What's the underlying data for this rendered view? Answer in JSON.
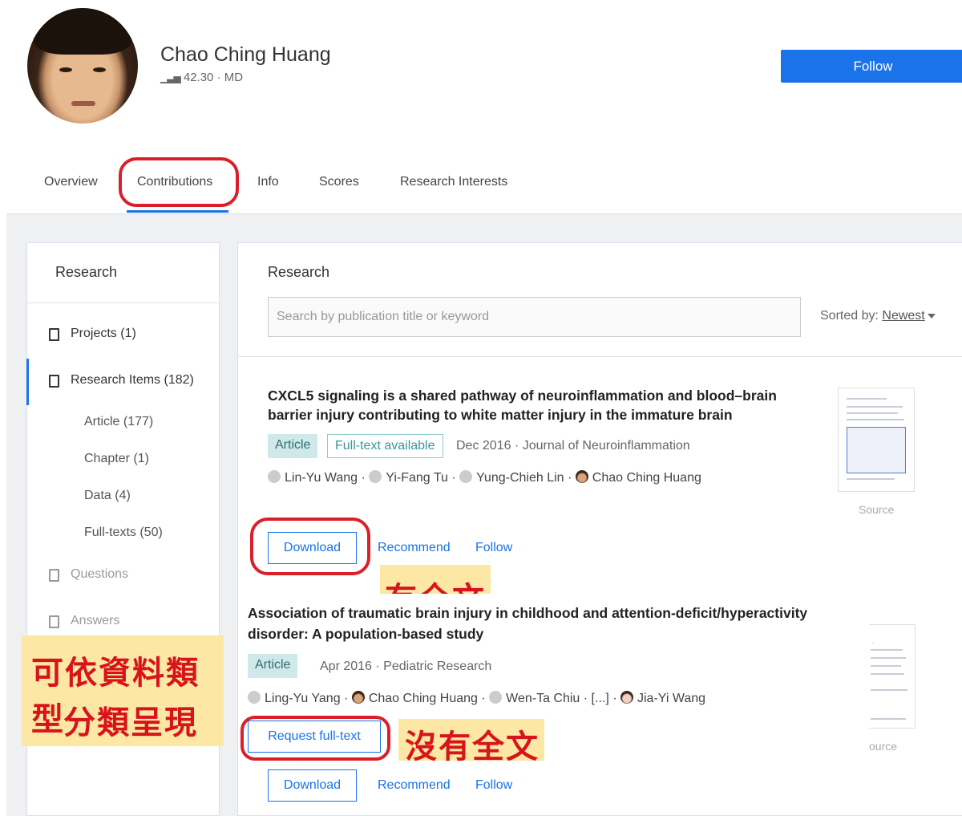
{
  "profile": {
    "name": "Chao Ching Huang",
    "score": "42.30",
    "degree": "MD",
    "follow_label": "Follow"
  },
  "tabs": [
    {
      "label": "Overview"
    },
    {
      "label": "Contributions",
      "active": true
    },
    {
      "label": "Info"
    },
    {
      "label": "Scores"
    },
    {
      "label": "Research Interests"
    }
  ],
  "sidebar": {
    "title": "Research",
    "items": [
      {
        "label": "Projects (1)"
      },
      {
        "label": "Research Items (182)",
        "active": true
      }
    ],
    "sub_items": [
      {
        "label": "Article (177)"
      },
      {
        "label": "Chapter (1)"
      },
      {
        "label": "Data (4)"
      },
      {
        "label": "Full-texts (50)"
      }
    ],
    "disabled_items": [
      {
        "label": "Questions"
      },
      {
        "label": "Answers"
      }
    ]
  },
  "main": {
    "title": "Research",
    "search_placeholder": "Search by publication title or keyword",
    "sort_label": "Sorted by:",
    "sort_value": "Newest"
  },
  "publications": [
    {
      "title_line1": "CXCL5 signaling is a shared pathway of neuroinflammation and blood–brain",
      "title_line2": "barrier injury contributing to white matter injury in the immature brain",
      "type": "Article",
      "fulltext": "Full-text available",
      "meta": "Dec 2016 · Journal of Neuroinflammation",
      "authors": [
        "Lin-Yu Wang",
        "Yi-Fang Tu",
        "Yung-Chieh Lin",
        "Chao Ching Huang"
      ],
      "thumb_caption": "Source",
      "download_label": "Download",
      "recommend_label": "Recommend",
      "follow_label": "Follow"
    },
    {
      "title_line1": "Association of traumatic brain injury in childhood and attention-deficit/hyperactivity",
      "title_line2": "disorder: A population-based study",
      "type": "Article",
      "meta": "Apr 2016 · Pediatric Research",
      "authors": [
        "Ling-Yu Yang",
        "Chao Ching Huang",
        "Wen-Ta Chiu",
        "[...]",
        "Jia-Yi Wang"
      ],
      "thumb_caption": "ource",
      "request_label": "Request full-text",
      "download_label": "Download",
      "recommend_label": "Recommend",
      "follow_label": "Follow"
    }
  ],
  "annotations": {
    "has_fulltext": "有全文",
    "no_fulltext": "沒有全文",
    "classify_line1": "可依資料類型",
    "classify_line2": "分類呈現"
  },
  "colors": {
    "accent": "#1a73e8",
    "annotation_red": "#d7141b",
    "annotation_yellow": "#fde7a4"
  }
}
